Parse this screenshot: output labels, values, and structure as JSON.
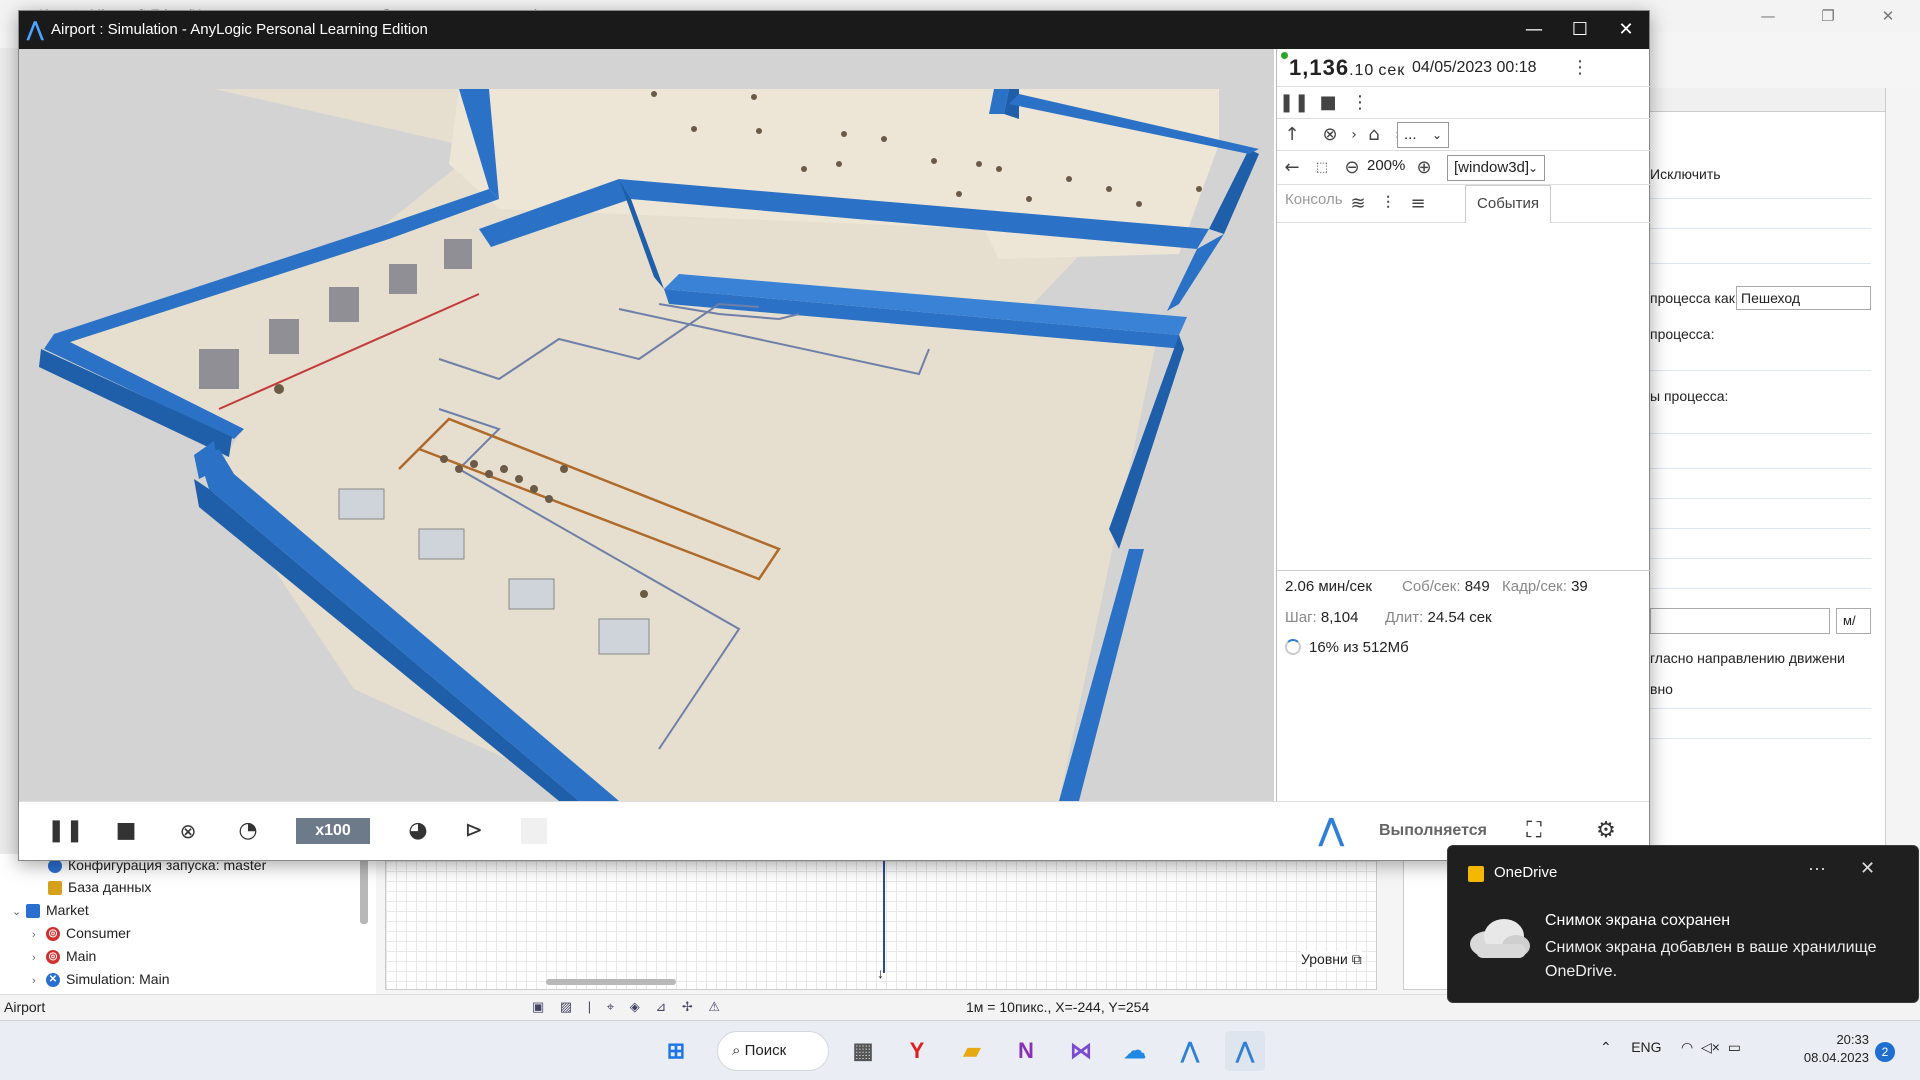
{
  "background_ide": {
    "title": "Airport - Microsoft Edge (Использовать для ссылок к образовательным целям)",
    "props": {
      "exclude_label": "Исключить",
      "process_as_label": "процесса как:",
      "process_as_value": "Пешеход",
      "process_label": "процесса:",
      "type_process_label": "ы процесса:",
      "unit_value": "м/",
      "direction_label": "гласно направлению движени",
      "misc_label": "вно"
    },
    "tree": {
      "items": [
        {
          "label": "Конфигурация запуска: master",
          "icon_color": "#2a6fd0"
        },
        {
          "label": "База данных",
          "icon_color": "#d6a21e"
        },
        {
          "label": "Market",
          "icon_color": "#2a6fd0"
        },
        {
          "label": "Consumer",
          "icon_color": "#d03030"
        },
        {
          "label": "Main",
          "icon_color": "#d03030"
        },
        {
          "label": "Simulation: Main",
          "icon_color": "#2a6fd0"
        }
      ]
    },
    "graph": {
      "levels_label": "Уровни"
    },
    "statusbar": {
      "left": "Airport",
      "coords": "1м = 10пикс., X=-244, Y=254"
    }
  },
  "sim_window": {
    "title": "Airport : Simulation - AnyLogic Personal Learning Edition",
    "controls": {
      "minimize": "—",
      "maximize": "☐",
      "close": "✕"
    },
    "side_panel": {
      "time_main": "1,136",
      "time_frac": ".10",
      "time_unit": "сек",
      "date": "04/05/2023 00:18",
      "nav_select": "...",
      "zoom": "200%",
      "window_select": "[window3d]",
      "tab_console": "Консоль",
      "tab_events": "События",
      "stats": {
        "speed": "2.06 мин/сек",
        "ev_label": "Соб/сек:",
        "ev_value": "849",
        "fr_label": "Кадр/сек:",
        "fr_value": "39",
        "step_label": "Шаг:",
        "step_value": "8,104",
        "dur_label": "Длит:",
        "dur_value": "24.54 сек",
        "memory": "16% из 512Мб"
      }
    },
    "toolbar": {
      "speed_label": "x100",
      "status": "Выполняется"
    }
  },
  "taskbar": {
    "search_label": "Поиск",
    "lang": "ENG",
    "time": "20:33",
    "date": "08.04.2023",
    "notifications": "2"
  },
  "toast": {
    "app": "OneDrive",
    "more": "···",
    "close": "✕",
    "heading": "Снимок экрана сохранен",
    "body": "Снимок экрана добавлен в ваше хранилище OneDrive."
  },
  "colors": {
    "wall": "#2b72c6",
    "floor": "#e5ddcc",
    "sim_titlebar": "#1a1a1a",
    "speed_badge": "#6d7a89",
    "toast_bg": "#1f1f1f"
  }
}
